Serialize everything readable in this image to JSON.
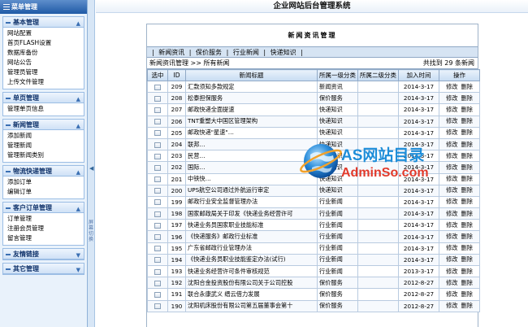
{
  "sidebar": {
    "header": "菜单管理",
    "groups": [
      {
        "title": "基本管理",
        "open": true,
        "items": [
          "网站配置",
          "首页FLASH设置",
          "数据库备份",
          "网站公告",
          "管理员管理",
          "上传文件管理"
        ]
      },
      {
        "title": "单页管理",
        "open": true,
        "items": [
          "管理单页信息"
        ]
      },
      {
        "title": "新闻管理",
        "open": true,
        "items": [
          "添加新闻",
          "管理新闻",
          "管理新闻类别"
        ]
      },
      {
        "title": "物流快递管理",
        "open": true,
        "items": [
          "添加订单",
          "编辑订单"
        ]
      },
      {
        "title": "客户订单管理",
        "open": true,
        "items": [
          "订单管理",
          "注册会员管理",
          "留言管理"
        ]
      },
      {
        "title": "友情链接",
        "open": false,
        "items": []
      },
      {
        "title": "其它管理",
        "open": false,
        "items": []
      }
    ]
  },
  "splitter": {
    "label": "屏幕切换"
  },
  "main": {
    "site_title": "企业网站后台管理系统",
    "panel_title": "新闻资讯管理",
    "tabs": [
      "新闻资讯",
      "保价服务",
      "行业新闻",
      "快递知识"
    ],
    "breadcrumb": "新闻资讯管理 >> 所有新闻",
    "count_text": "共找到 29 条新闻",
    "columns": [
      "选中",
      "ID",
      "新闻标题",
      "所属一级分类",
      "所属二级分类",
      "加入时间",
      "操作"
    ],
    "actions": {
      "edit": "修改",
      "delete": "删除"
    },
    "rows": [
      {
        "id": "209",
        "title": "汇款须知多款规定",
        "cat1": "新闻资讯",
        "cat2": "",
        "date": "2014-3-17"
      },
      {
        "id": "208",
        "title": "松泰担保服务",
        "cat1": "保价服务",
        "cat2": "",
        "date": "2014-3-17"
      },
      {
        "id": "207",
        "title": "邮政快递全面提速",
        "cat1": "快递知识",
        "cat2": "",
        "date": "2014-3-17"
      },
      {
        "id": "206",
        "title": "TNT重塑大中国区管理架构",
        "cat1": "快递知识",
        "cat2": "",
        "date": "2014-3-17"
      },
      {
        "id": "205",
        "title": "邮政快递\"星速\"…",
        "cat1": "快递知识",
        "cat2": "",
        "date": "2014-3-17"
      },
      {
        "id": "204",
        "title": "联邦…",
        "cat1": "快递知识",
        "cat2": "",
        "date": "2014-3-17"
      },
      {
        "id": "203",
        "title": "民营…",
        "cat1": "快递知识",
        "cat2": "",
        "date": "2014-3-17"
      },
      {
        "id": "202",
        "title": "国际…",
        "cat1": "快递知识",
        "cat2": "",
        "date": "2014-3-17"
      },
      {
        "id": "201",
        "title": "中铁快…",
        "cat1": "快递知识",
        "cat2": "",
        "date": "2014-3-17"
      },
      {
        "id": "200",
        "title": "UPS航空公司通过外航运行审定",
        "cat1": "快递知识",
        "cat2": "",
        "date": "2014-3-17"
      },
      {
        "id": "199",
        "title": "邮政行业安全监督管理办法",
        "cat1": "行业新闻",
        "cat2": "",
        "date": "2014-3-17"
      },
      {
        "id": "198",
        "title": "国家邮政局关于印发《快递业务经营许可",
        "cat1": "行业新闻",
        "cat2": "",
        "date": "2014-3-17"
      },
      {
        "id": "197",
        "title": "快递业务员国家职业技能标准",
        "cat1": "行业新闻",
        "cat2": "",
        "date": "2014-3-17"
      },
      {
        "id": "196",
        "title": "《快递服务》邮政行业标准",
        "cat1": "行业新闻",
        "cat2": "",
        "date": "2014-3-17"
      },
      {
        "id": "195",
        "title": "广东省邮政行业管理办法",
        "cat1": "行业新闻",
        "cat2": "",
        "date": "2014-3-17"
      },
      {
        "id": "194",
        "title": "《快递业务员职业技能鉴定办法(试行)",
        "cat1": "行业新闻",
        "cat2": "",
        "date": "2014-3-17"
      },
      {
        "id": "193",
        "title": "快递业务经营许可条件审核规范",
        "cat1": "行业新闻",
        "cat2": "",
        "date": "2013-3-17"
      },
      {
        "id": "192",
        "title": "沈阳合金投资股份有限公司关于公司控股",
        "cat1": "保价服务",
        "cat2": "",
        "date": "2012-8-27"
      },
      {
        "id": "191",
        "title": "联合永康武义 缙云借力发展",
        "cat1": "保价服务",
        "cat2": "",
        "date": "2012-8-27"
      },
      {
        "id": "190",
        "title": "沈阳机床股份有限公司第五届董事会第十",
        "cat1": "保价服务",
        "cat2": "",
        "date": "2012-8-27"
      }
    ]
  },
  "watermark": {
    "line1": "AS网站目录",
    "line2": "AdminSo.com"
  },
  "colors": {
    "accent": "#1f5aa6",
    "grid_border": "#90a9c6",
    "header_bg": "#d6e4f3"
  }
}
